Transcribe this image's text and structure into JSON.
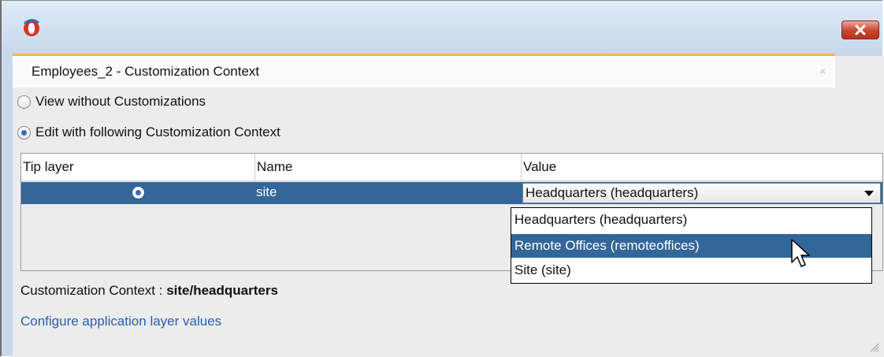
{
  "window": {
    "panel_title": "Employees_2 - Customization Context",
    "panel_close": "×"
  },
  "options": {
    "view_without": "View without Customizations",
    "edit_with": "Edit with following Customization Context",
    "selected": "edit_with"
  },
  "table": {
    "headers": [
      "Tip layer",
      "Name",
      "Value"
    ],
    "rows": [
      {
        "tip_layer_selected": true,
        "name": "site",
        "value": "Headquarters (headquarters)"
      }
    ]
  },
  "dropdown": {
    "options": [
      "Headquarters (headquarters)",
      "Remote Offices (remoteoffices)",
      "Site (site)"
    ],
    "highlighted": "Remote Offices (remoteoffices)"
  },
  "status": {
    "label": "Customization Context : ",
    "value": "site/headquarters"
  },
  "link": {
    "text": "Configure application layer values"
  },
  "icons": {
    "app": "oracle-jdeveloper-logo-icon",
    "close": "close-icon",
    "cursor": "mouse-pointer-icon",
    "grip": "resize-grip-icon"
  },
  "colors": {
    "selection": "#336699",
    "link": "#2a5db0",
    "tab_accent": "#e9ab52",
    "close_button": "#c9452e"
  }
}
